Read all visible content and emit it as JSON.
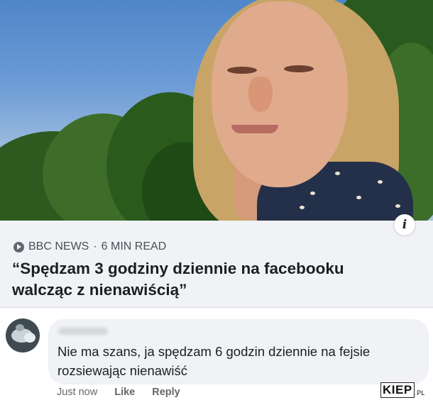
{
  "post": {
    "photo_icon": "info-icon",
    "info_badge": "i"
  },
  "link_preview": {
    "source_icon": "bbc-news-source-icon",
    "source": "BBC NEWS",
    "separator": "·",
    "read_time": "6 MIN READ",
    "headline": "“Spędzam 3 godziny dziennie na facebooku walcząc z nienawiścią”"
  },
  "comment": {
    "text": "Nie ma szans, ja spędzam 6 godzin dziennie na fejsie rozsiewając nienawiść",
    "time": "Just now",
    "like_label": "Like",
    "reply_label": "Reply"
  },
  "watermark": {
    "main": "KIEP",
    "suffix": ".PL"
  },
  "colors": {
    "preview_background": "#f0f2f5",
    "headline_text": "#1c1e21",
    "meta_text": "#65676b"
  }
}
